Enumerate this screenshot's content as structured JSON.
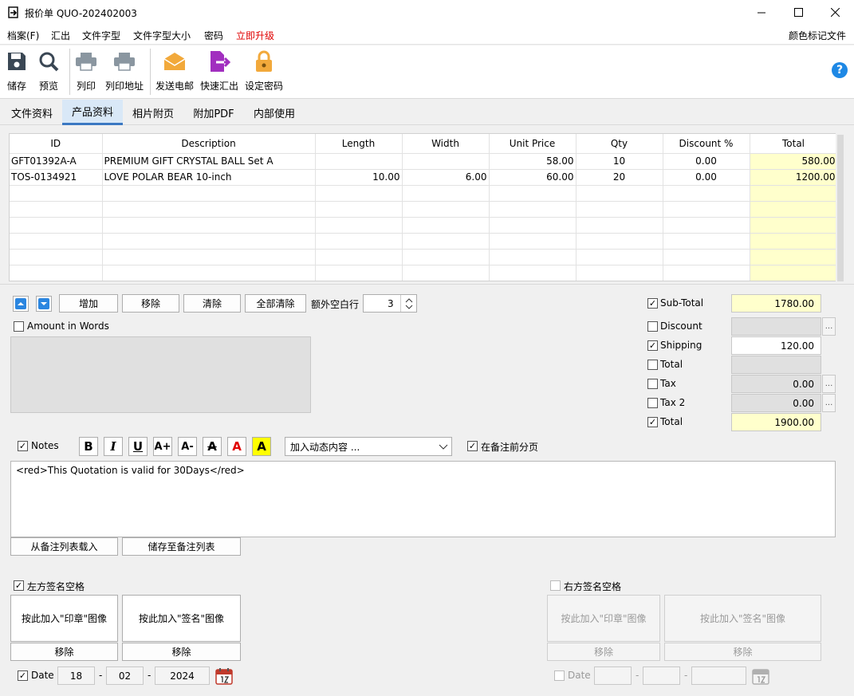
{
  "window": {
    "title": "报价单 QUO-202402003"
  },
  "menu": {
    "items": [
      "档案(F)",
      "汇出",
      "文件字型",
      "文件字型大小",
      "密码"
    ],
    "upgrade": "立即升级",
    "right": "颜色标记文件"
  },
  "toolbar": {
    "save": "储存",
    "preview": "预览",
    "print": "列印",
    "print_address": "列印地址",
    "send_email": "发送电邮",
    "quick_export": "快速汇出",
    "set_password": "设定密码"
  },
  "tabs": [
    "文件资料",
    "产品资料",
    "相片附页",
    "附加PDF",
    "内部使用"
  ],
  "grid": {
    "headers": [
      "ID",
      "Description",
      "Length",
      "Width",
      "Unit Price",
      "Qty",
      "Discount %",
      "Total"
    ],
    "rows": [
      [
        "GFT01392A-A",
        "PREMIUM GIFT CRYSTAL BALL Set A",
        "",
        "",
        "58.00",
        "10",
        "0.00",
        "580.00"
      ],
      [
        "TOS-0134921",
        "LOVE POLAR BEAR 10-inch",
        "10.00",
        "6.00",
        "60.00",
        "20",
        "0.00",
        "1200.00"
      ],
      [
        "",
        "",
        "",
        "",
        "",
        "",
        "",
        ""
      ],
      [
        "",
        "",
        "",
        "",
        "",
        "",
        "",
        ""
      ],
      [
        "",
        "",
        "",
        "",
        "",
        "",
        "",
        ""
      ],
      [
        "",
        "",
        "",
        "",
        "",
        "",
        "",
        ""
      ],
      [
        "",
        "",
        "",
        "",
        "",
        "",
        "",
        ""
      ],
      [
        "",
        "",
        "",
        "",
        "",
        "",
        "",
        ""
      ]
    ]
  },
  "row_controls": {
    "add": "增加",
    "remove": "移除",
    "clear": "清除",
    "clear_all": "全部清除",
    "extra_blank_label": "额外空白行",
    "extra_blank_value": "3"
  },
  "amount_in_words": {
    "label": "Amount in Words",
    "checked": false
  },
  "summary": {
    "subtotal": {
      "label": "Sub-Total",
      "checked": true,
      "value": "1780.00"
    },
    "discount": {
      "label": "Discount",
      "checked": false,
      "value": ""
    },
    "shipping": {
      "label": "Shipping",
      "checked": true,
      "value": "120.00"
    },
    "total1": {
      "label": "Total",
      "checked": false,
      "value": ""
    },
    "tax": {
      "label": "Tax",
      "checked": false,
      "value": "0.00"
    },
    "tax2": {
      "label": "Tax 2",
      "checked": false,
      "value": "0.00"
    },
    "total": {
      "label": "Total",
      "checked": true,
      "value": "1900.00"
    }
  },
  "notes": {
    "label": "Notes",
    "checked": true,
    "dynamic_placeholder": "加入动态内容 ...",
    "page_break_label": "在备注前分页",
    "page_break_checked": true,
    "text": "<red>This Quotation is valid for 30Days</red>",
    "load_list": "从备注列表载入",
    "save_list": "储存至备注列表"
  },
  "left_signature": {
    "label": "左方签名空格",
    "checked": true,
    "stamp": "按此加入\"印章\"图像",
    "sign": "按此加入\"签名\"图像",
    "remove": "移除",
    "date_label": "Date",
    "date_checked": true,
    "day": "18",
    "month": "02",
    "year": "2024"
  },
  "right_signature": {
    "label": "右方签名空格",
    "checked": false,
    "stamp": "按此加入\"印章\"图像",
    "sign": "按此加入\"签名\"图像",
    "remove": "移除",
    "date_label": "Date",
    "date_checked": false
  },
  "colors": {
    "accent": "#3b78c2",
    "yellow_cell": "#ffffcc",
    "upgrade_red": "#e00000"
  }
}
